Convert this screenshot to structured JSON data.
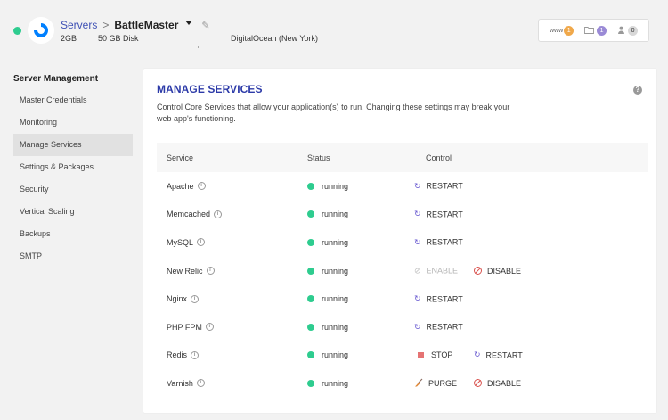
{
  "header": {
    "breadcrumb_root": "Servers",
    "breadcrumb_sep": ">",
    "server_name": "BattleMaster",
    "ram": "2GB",
    "disk": "50 GB Disk",
    "location": "DigitalOcean (New York)",
    "counters": [
      {
        "icon": "www-icon",
        "label": "www",
        "count": "1",
        "color": "#f0a84a"
      },
      {
        "icon": "folder-icon",
        "label": "",
        "count": "1",
        "color": "#9a8ad6"
      },
      {
        "icon": "user-icon",
        "label": "",
        "count": "0",
        "color": "#d8d8d8"
      }
    ]
  },
  "sidebar": {
    "title": "Server Management",
    "items": [
      {
        "label": "Master Credentials",
        "active": false
      },
      {
        "label": "Monitoring",
        "active": false
      },
      {
        "label": "Manage Services",
        "active": true
      },
      {
        "label": "Settings & Packages",
        "active": false
      },
      {
        "label": "Security",
        "active": false
      },
      {
        "label": "Vertical Scaling",
        "active": false
      },
      {
        "label": "Backups",
        "active": false
      },
      {
        "label": "SMTP",
        "active": false
      }
    ]
  },
  "panel": {
    "title": "MANAGE SERVICES",
    "description": "Control Core Services that allow your application(s) to run. Changing these settings may break your web app's functioning.",
    "columns": {
      "service": "Service",
      "status": "Status",
      "control": "Control"
    },
    "services": [
      {
        "name": "Apache",
        "status": "running",
        "controls": [
          {
            "label": "RESTART",
            "icon": "restart-icon",
            "enabled": true
          }
        ]
      },
      {
        "name": "Memcached",
        "status": "running",
        "controls": [
          {
            "label": "RESTART",
            "icon": "restart-icon",
            "enabled": true
          }
        ]
      },
      {
        "name": "MySQL",
        "status": "running",
        "controls": [
          {
            "label": "RESTART",
            "icon": "restart-icon",
            "enabled": true
          }
        ]
      },
      {
        "name": "New Relic",
        "status": "running",
        "controls": [
          {
            "label": "ENABLE",
            "icon": "enable-icon",
            "enabled": false
          },
          {
            "label": "DISABLE",
            "icon": "ban-icon",
            "enabled": true
          }
        ]
      },
      {
        "name": "Nginx",
        "status": "running",
        "controls": [
          {
            "label": "RESTART",
            "icon": "restart-icon",
            "enabled": true
          }
        ]
      },
      {
        "name": "PHP FPM",
        "status": "running",
        "controls": [
          {
            "label": "RESTART",
            "icon": "restart-icon",
            "enabled": true
          }
        ]
      },
      {
        "name": "Redis",
        "status": "running",
        "controls": [
          {
            "label": "STOP",
            "icon": "stop-icon",
            "enabled": true
          },
          {
            "label": "RESTART",
            "icon": "restart-icon",
            "enabled": true
          }
        ]
      },
      {
        "name": "Varnish",
        "status": "running",
        "controls": [
          {
            "label": "PURGE",
            "icon": "broom-icon",
            "enabled": true
          },
          {
            "label": "DISABLE",
            "icon": "ban-icon",
            "enabled": true
          }
        ]
      }
    ]
  },
  "colors": {
    "accent": "#2c3aa8",
    "running": "#2ecc8f",
    "restart": "#6a5bd1",
    "danger": "#d9534f"
  }
}
